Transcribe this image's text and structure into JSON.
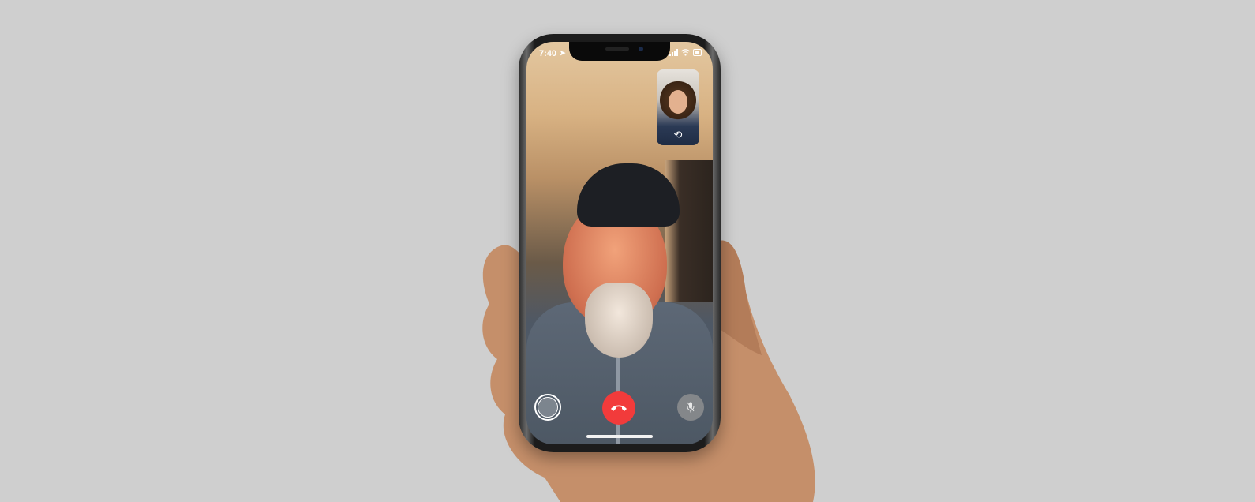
{
  "statusbar": {
    "time": "7:40",
    "location_icon": "location-arrow-icon",
    "signal_icon": "cellular-signal-icon",
    "wifi_icon": "wifi-icon",
    "battery_icon": "battery-icon"
  },
  "pip": {
    "flip_icon": "camera-flip-icon"
  },
  "controls": {
    "shutter_icon": "live-photo-shutter-icon",
    "end_call_icon": "end-call-icon",
    "mute_icon": "mute-microphone-icon",
    "end_call_color": "#f23b3b"
  },
  "colors": {
    "background": "#cfcfcf"
  }
}
